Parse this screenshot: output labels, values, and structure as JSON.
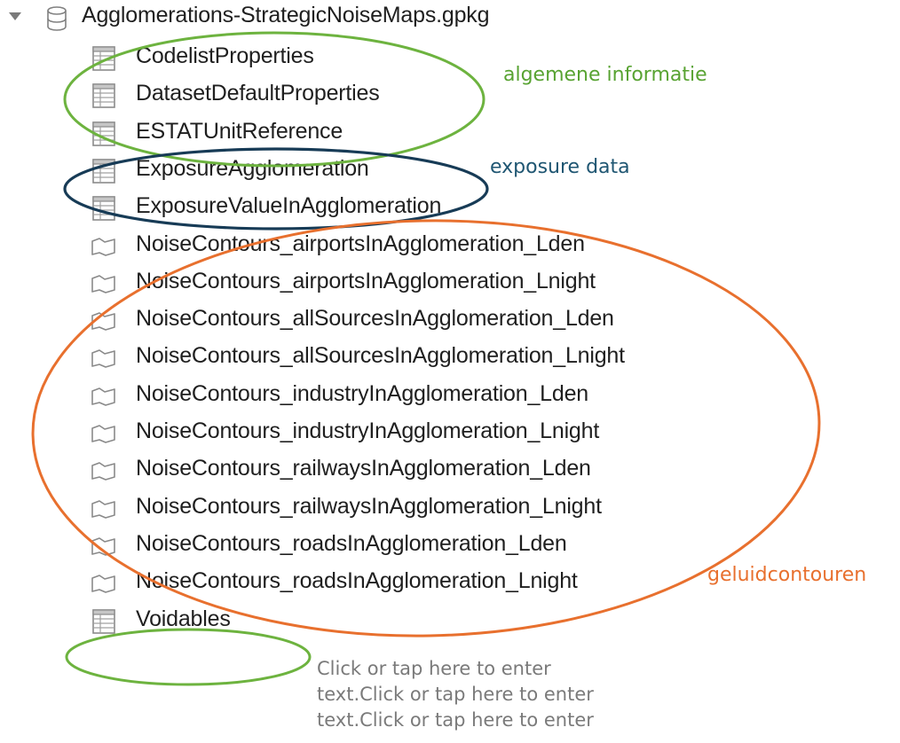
{
  "tree": {
    "root": {
      "label": "Agglomerations-StrategicNoiseMaps.gpkg",
      "expanded": true,
      "icon": "database-icon"
    },
    "items": [
      {
        "label": "CodelistProperties",
        "icon": "table-icon"
      },
      {
        "label": "DatasetDefaultProperties",
        "icon": "table-icon"
      },
      {
        "label": "ESTATUnitReference",
        "icon": "table-icon"
      },
      {
        "label": "ExposureAgglomeration",
        "icon": "table-icon"
      },
      {
        "label": "ExposureValueInAgglomeration",
        "icon": "table-icon"
      },
      {
        "label": "NoiseContours_airportsInAgglomeration_Lden",
        "icon": "polygon-icon"
      },
      {
        "label": "NoiseContours_airportsInAgglomeration_Lnight",
        "icon": "polygon-icon"
      },
      {
        "label": "NoiseContours_allSourcesInAgglomeration_Lden",
        "icon": "polygon-icon"
      },
      {
        "label": "NoiseContours_allSourcesInAgglomeration_Lnight",
        "icon": "polygon-icon"
      },
      {
        "label": "NoiseContours_industryInAgglomeration_Lden",
        "icon": "polygon-icon"
      },
      {
        "label": "NoiseContours_industryInAgglomeration_Lnight",
        "icon": "polygon-icon"
      },
      {
        "label": "NoiseContours_railwaysInAgglomeration_Lden",
        "icon": "polygon-icon"
      },
      {
        "label": "NoiseContours_railwaysInAgglomeration_Lnight",
        "icon": "polygon-icon"
      },
      {
        "label": "NoiseContours_roadsInAgglomeration_Lden",
        "icon": "polygon-icon"
      },
      {
        "label": "NoiseContours_roadsInAgglomeration_Lnight",
        "icon": "polygon-icon"
      },
      {
        "label": "Voidables",
        "icon": "table-icon"
      }
    ]
  },
  "annotations": {
    "general_info": {
      "text": "algemene informatie",
      "color": "#58a332"
    },
    "exposure_data": {
      "text": "exposure data",
      "color": "#1f5672"
    },
    "noise_contours": {
      "text": "geluidcontouren",
      "color": "#e8702e"
    }
  },
  "placeholder": {
    "lines": [
      "Click or tap here to enter",
      "text.Click or tap here to enter",
      "text.Click or tap here to enter"
    ]
  }
}
